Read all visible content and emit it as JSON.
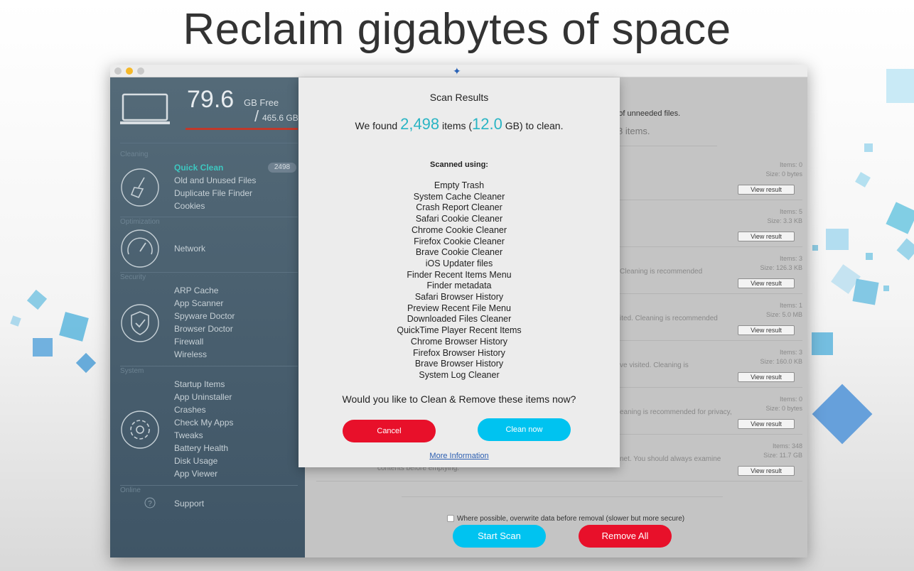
{
  "headline": "Reclaim gigabytes of space",
  "colors": {
    "accent_cyan": "#00c3f0",
    "danger_red": "#e8102a",
    "highlight_teal": "#2ab5c4",
    "sidebar_bg": "#4b6170"
  },
  "window": {
    "app_icon": "rocket-logo-icon"
  },
  "sidebar": {
    "free_value": "79.6",
    "free_label": "GB Free",
    "slash": "/",
    "total": "465.6 GB",
    "sections": {
      "cleaning": {
        "title": "Cleaning",
        "icon": "broom-icon",
        "items": [
          "Quick Clean",
          "Old and Unused Files",
          "Duplicate File Finder",
          "Cookies"
        ],
        "badge": "2498"
      },
      "optimization": {
        "title": "Optimization",
        "icon": "speedometer-icon",
        "items": [
          "Network"
        ]
      },
      "security": {
        "title": "Security",
        "icon": "shield-check-icon",
        "items": [
          "ARP Cache",
          "App Scanner",
          "Spyware Doctor",
          "Browser Doctor",
          "Firewall",
          "Wireless"
        ]
      },
      "system": {
        "title": "System",
        "icon": "gear-icon",
        "items": [
          "Startup Items",
          "App Uninstaller",
          "Crashes",
          "Check My Apps",
          "Tweaks",
          "Battery Health",
          "Disk Usage",
          "App Viewer"
        ]
      },
      "online": {
        "title": "Online",
        "icon": "question-icon",
        "items": [
          "Support"
        ]
      }
    }
  },
  "main": {
    "intro": "up of unneeded files.",
    "items_found": "8 items.",
    "rows": [
      {
        "items": "Items: 0",
        "size": "Size: 0 bytes",
        "desc": "",
        "button": "View result"
      },
      {
        "items": "Items: 5",
        "size": "Size: 3.3 KB",
        "desc": "",
        "button": "View result"
      },
      {
        "items": "Items: 3",
        "size": "Size: 126.3 KB",
        "desc": "Cleaning is recommended",
        "button": "View result"
      },
      {
        "items": "Items: 1",
        "size": "Size: 5.0 MB",
        "desc": "ited.  Cleaning is recommended",
        "button": "View result"
      },
      {
        "items": "Items: 3",
        "size": "Size: 160.0 KB",
        "desc": "ve visited.  Cleaning is",
        "button": "View result"
      },
      {
        "items": "Items: 0",
        "size": "Size: 0 bytes",
        "desc": "eaning is recommended for privacy,",
        "button": "View result"
      },
      {
        "items": "Items: 348",
        "size": "Size: 11.7 GB",
        "desc": "net.  You should always examine",
        "button": "View result"
      }
    ],
    "last_row_extra": "contents before emptying.",
    "overwrite_label": "Where possible, overwrite data before removal (slower but more secure)",
    "start_scan": "Start Scan",
    "remove_all": "Remove All"
  },
  "dialog": {
    "title": "Scan Results",
    "found_prefix": "We found ",
    "found_count": "2,498",
    "found_mid": " items (",
    "found_size": "12.0",
    "found_suffix": " GB) to clean.",
    "scanned_using": "Scanned using:",
    "scanners": [
      "Empty Trash",
      "System Cache Cleaner",
      "Crash Report Cleaner",
      "Safari Cookie Cleaner",
      "Chrome Cookie Cleaner",
      "Firefox Cookie Cleaner",
      "Brave Cookie Cleaner",
      "iOS Updater files",
      "Finder Recent Items Menu",
      "Finder metadata",
      "Safari Browser History",
      "Preview Recent File Menu",
      "Downloaded Files Cleaner",
      "QuickTime Player Recent Items",
      "Chrome Browser History",
      "Firefox Browser History",
      "Brave Browser History",
      "System Log Cleaner"
    ],
    "question": "Would you like to Clean & Remove these items now?",
    "cancel": "Cancel",
    "clean_now": "Clean now",
    "more_info": "More Information"
  }
}
